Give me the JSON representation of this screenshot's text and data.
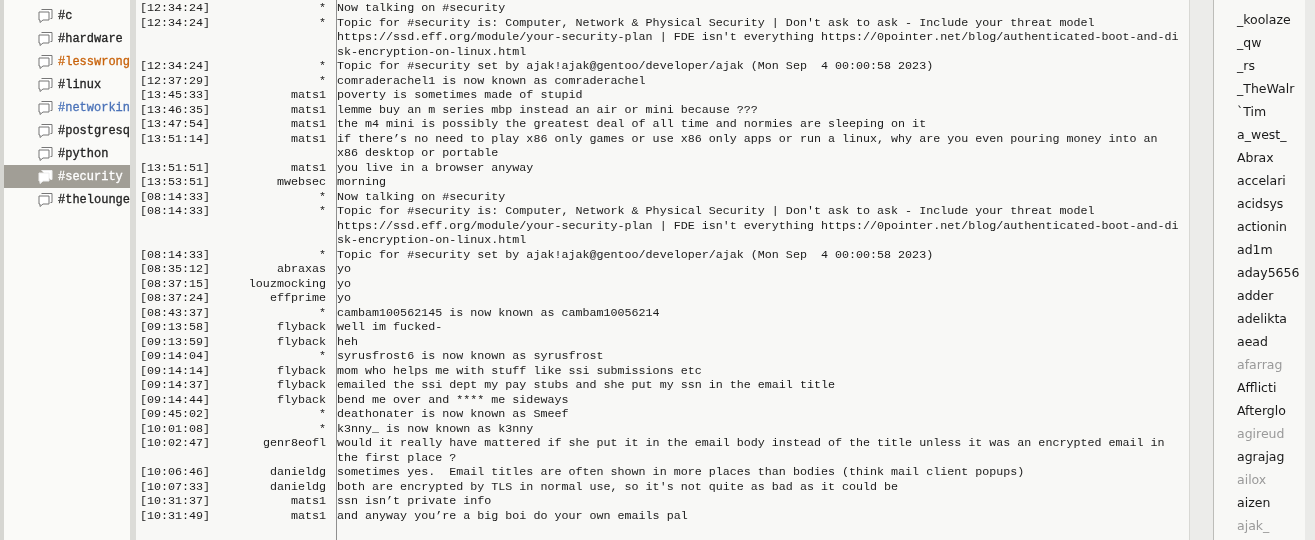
{
  "channels": [
    {
      "name": "#c",
      "selected": false,
      "color": "#222222"
    },
    {
      "name": "#hardware",
      "selected": false,
      "color": "#222222"
    },
    {
      "name": "#lesswrong",
      "selected": false,
      "color": "#c8620a"
    },
    {
      "name": "#linux",
      "selected": false,
      "color": "#222222"
    },
    {
      "name": "#networkin",
      "selected": false,
      "color": "#4a72b8"
    },
    {
      "name": "#postgresq",
      "selected": false,
      "color": "#222222"
    },
    {
      "name": "#python",
      "selected": false,
      "color": "#222222"
    },
    {
      "name": "#security",
      "selected": true,
      "color": "#ffffff"
    },
    {
      "name": "#thelounge",
      "selected": false,
      "color": "#222222"
    }
  ],
  "messages": [
    {
      "time": "[12:34:24]",
      "nick": "*",
      "text": "Now talking on #security"
    },
    {
      "time": "[12:34:24]",
      "nick": "*",
      "text": "Topic for #security is: Computer, Network & Physical Security | Don't ask to ask - Include your threat model\nhttps://ssd.eff.org/module/your-security-plan | FDE isn't everything https://0pointer.net/blog/authenticated-boot-and-di\nsk-encryption-on-linux.html"
    },
    {
      "time": "[12:34:24]",
      "nick": "*",
      "text": "Topic for #security set by ajak!ajak@gentoo/developer/ajak (Mon Sep  4 00:00:58 2023)"
    },
    {
      "time": "[12:37:29]",
      "nick": "*",
      "text": "comraderachel1 is now known as comraderachel"
    },
    {
      "time": "[13:45:33]",
      "nick": "mats1",
      "text": "poverty is sometimes made of stupid"
    },
    {
      "time": "[13:46:35]",
      "nick": "mats1",
      "text": "lemme buy an m series mbp instead an air or mini because ???"
    },
    {
      "time": "[13:47:54]",
      "nick": "mats1",
      "text": "the m4 mini is possibly the greatest deal of all time and normies are sleeping on it"
    },
    {
      "time": "[13:51:14]",
      "nick": "mats1",
      "text": "if there’s no need to play x86 only games or use x86 only apps or run a linux, why are you even pouring money into an\nx86 desktop or portable"
    },
    {
      "time": "[13:51:51]",
      "nick": "mats1",
      "text": "you live in a browser anyway"
    },
    {
      "time": "[13:53:51]",
      "nick": "mwebsec",
      "text": "morning"
    },
    {
      "time": "[08:14:33]",
      "nick": "*",
      "text": "Now talking on #security"
    },
    {
      "time": "[08:14:33]",
      "nick": "*",
      "text": "Topic for #security is: Computer, Network & Physical Security | Don't ask to ask - Include your threat model\nhttps://ssd.eff.org/module/your-security-plan | FDE isn't everything https://0pointer.net/blog/authenticated-boot-and-di\nsk-encryption-on-linux.html"
    },
    {
      "time": "[08:14:33]",
      "nick": "*",
      "text": "Topic for #security set by ajak!ajak@gentoo/developer/ajak (Mon Sep  4 00:00:58 2023)"
    },
    {
      "time": "[08:35:12]",
      "nick": "abraxas",
      "text": "yo"
    },
    {
      "time": "[08:37:15]",
      "nick": "louzmocking",
      "text": "yo"
    },
    {
      "time": "[08:37:24]",
      "nick": "effprime",
      "text": "yo"
    },
    {
      "time": "[08:43:37]",
      "nick": "*",
      "text": "cambam100562145 is now known as cambam10056214"
    },
    {
      "time": "[09:13:58]",
      "nick": "flyback",
      "text": "well im fucked-"
    },
    {
      "time": "[09:13:59]",
      "nick": "flyback",
      "text": "heh"
    },
    {
      "time": "[09:14:04]",
      "nick": "*",
      "text": "syrusfrost6 is now known as syrusfrost"
    },
    {
      "time": "[09:14:14]",
      "nick": "flyback",
      "text": "mom who helps me with stuff like ssi submissions etc"
    },
    {
      "time": "[09:14:37]",
      "nick": "flyback",
      "text": "emailed the ssi dept my pay stubs and she put my ssn in the email title"
    },
    {
      "time": "[09:14:44]",
      "nick": "flyback",
      "text": "bend me over and **** me sideways"
    },
    {
      "time": "[09:45:02]",
      "nick": "*",
      "text": "deathonater is now known as Smeef"
    },
    {
      "time": "[10:01:08]",
      "nick": "*",
      "text": "k3nny_ is now known as k3nny"
    },
    {
      "time": "[10:02:47]",
      "nick": "genr8eofl",
      "text": "would it really have mattered if she put it in the email body instead of the title unless it was an encrypted email in\nthe first place ?"
    },
    {
      "time": "[10:06:46]",
      "nick": "danieldg",
      "text": "sometimes yes.  Email titles are often shown in more places than bodies (think mail client popups)"
    },
    {
      "time": "[10:07:33]",
      "nick": "danieldg",
      "text": "both are encrypted by TLS in normal use, so it's not quite as bad as it could be"
    },
    {
      "time": "[10:31:37]",
      "nick": "mats1",
      "text": "ssn isn’t private info"
    },
    {
      "time": "[10:31:49]",
      "nick": "mats1",
      "text": "and anyway you’re a big boi do your own emails pal"
    }
  ],
  "users": [
    {
      "nick": "_koolaze",
      "away": false
    },
    {
      "nick": "_qw",
      "away": false
    },
    {
      "nick": "_rs",
      "away": false
    },
    {
      "nick": "_TheWalr",
      "away": false
    },
    {
      "nick": "`Tim",
      "away": false
    },
    {
      "nick": "a_west_",
      "away": false
    },
    {
      "nick": "Abrax",
      "away": false
    },
    {
      "nick": "accelari",
      "away": false
    },
    {
      "nick": "acidsys",
      "away": false
    },
    {
      "nick": "actionin",
      "away": false
    },
    {
      "nick": "ad1m",
      "away": false
    },
    {
      "nick": "aday5656",
      "away": false
    },
    {
      "nick": "adder",
      "away": false
    },
    {
      "nick": "adelikta",
      "away": false
    },
    {
      "nick": "aead",
      "away": false
    },
    {
      "nick": "afarrag",
      "away": true
    },
    {
      "nick": "Afflicti",
      "away": false
    },
    {
      "nick": "Afterglo",
      "away": false
    },
    {
      "nick": "agireud",
      "away": true
    },
    {
      "nick": "agrajag",
      "away": false
    },
    {
      "nick": "ailox",
      "away": true
    },
    {
      "nick": "aizen",
      "away": false
    },
    {
      "nick": "ajak_",
      "away": true
    }
  ]
}
